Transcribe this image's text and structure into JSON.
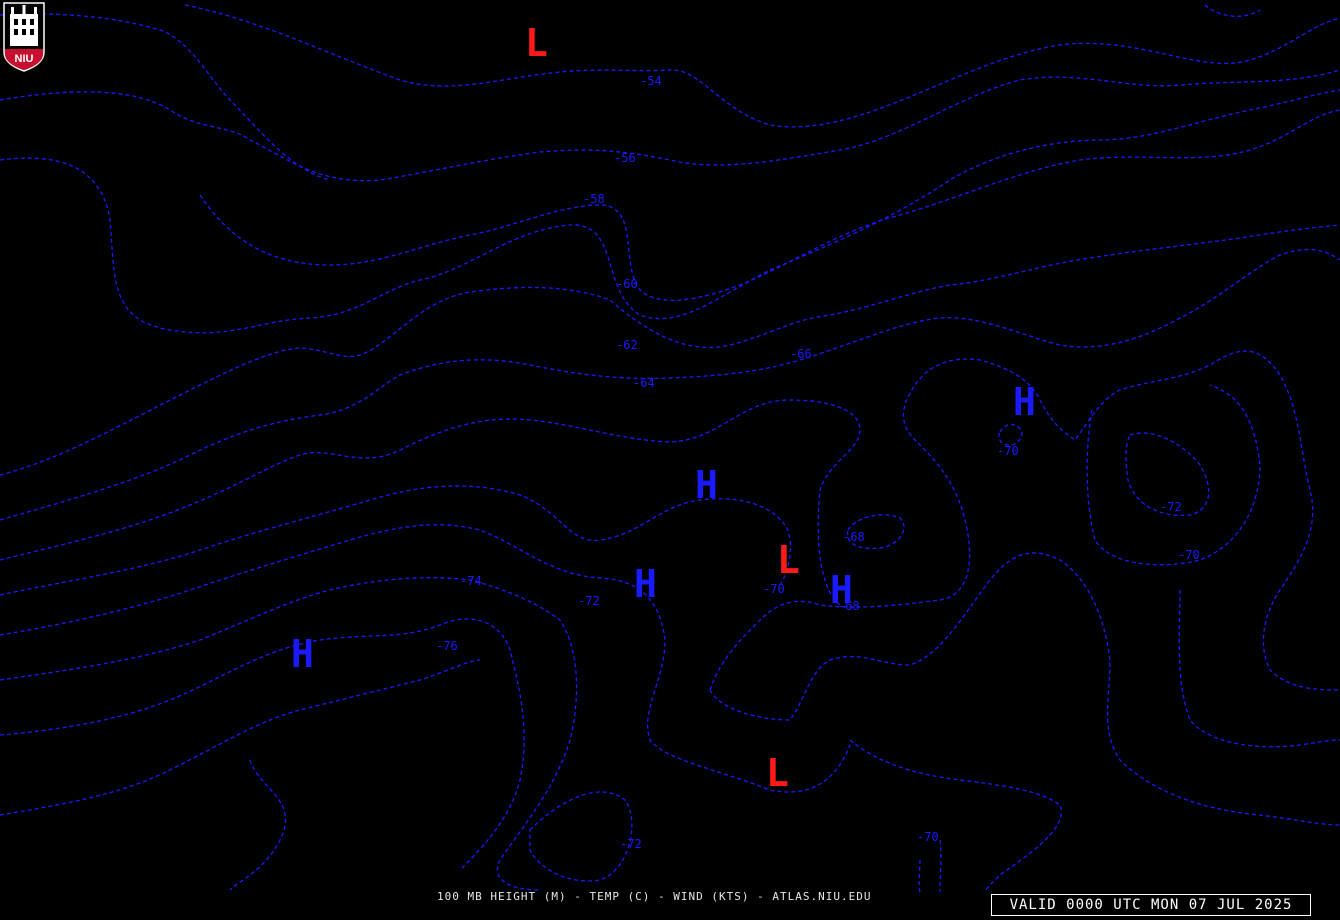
{
  "map": {
    "footer_title": "100 MB HEIGHT (M) - TEMP (C) - WIND (KTS) - ATLAS.NIU.EDU",
    "valid_time": "VALID 0000 UTC MON 07 JUL 2025",
    "logo_text": "NIU",
    "colors": {
      "background": "#000000",
      "contour": "#1a1aff",
      "low_marker": "#ff1a1a",
      "high_marker": "#1a1aff",
      "logo_red": "#c8102e",
      "text": "#ffffff"
    },
    "contour_labels": [
      "-54",
      "-56",
      "-58",
      "-60",
      "-62",
      "-64",
      "-66",
      "-68",
      "-70",
      "-72",
      "-74",
      "-76",
      "-70",
      "-72",
      "-70",
      "-72",
      "-70",
      "-68",
      "-70",
      "-74",
      "-72"
    ],
    "pressure_centers": [
      {
        "type": "low",
        "label": "L"
      },
      {
        "type": "low",
        "label": "L"
      },
      {
        "type": "low",
        "label": "L"
      },
      {
        "type": "high",
        "label": "H"
      },
      {
        "type": "high",
        "label": "H"
      },
      {
        "type": "high",
        "label": "H"
      },
      {
        "type": "high",
        "label": "H"
      },
      {
        "type": "high",
        "label": "H"
      }
    ]
  }
}
